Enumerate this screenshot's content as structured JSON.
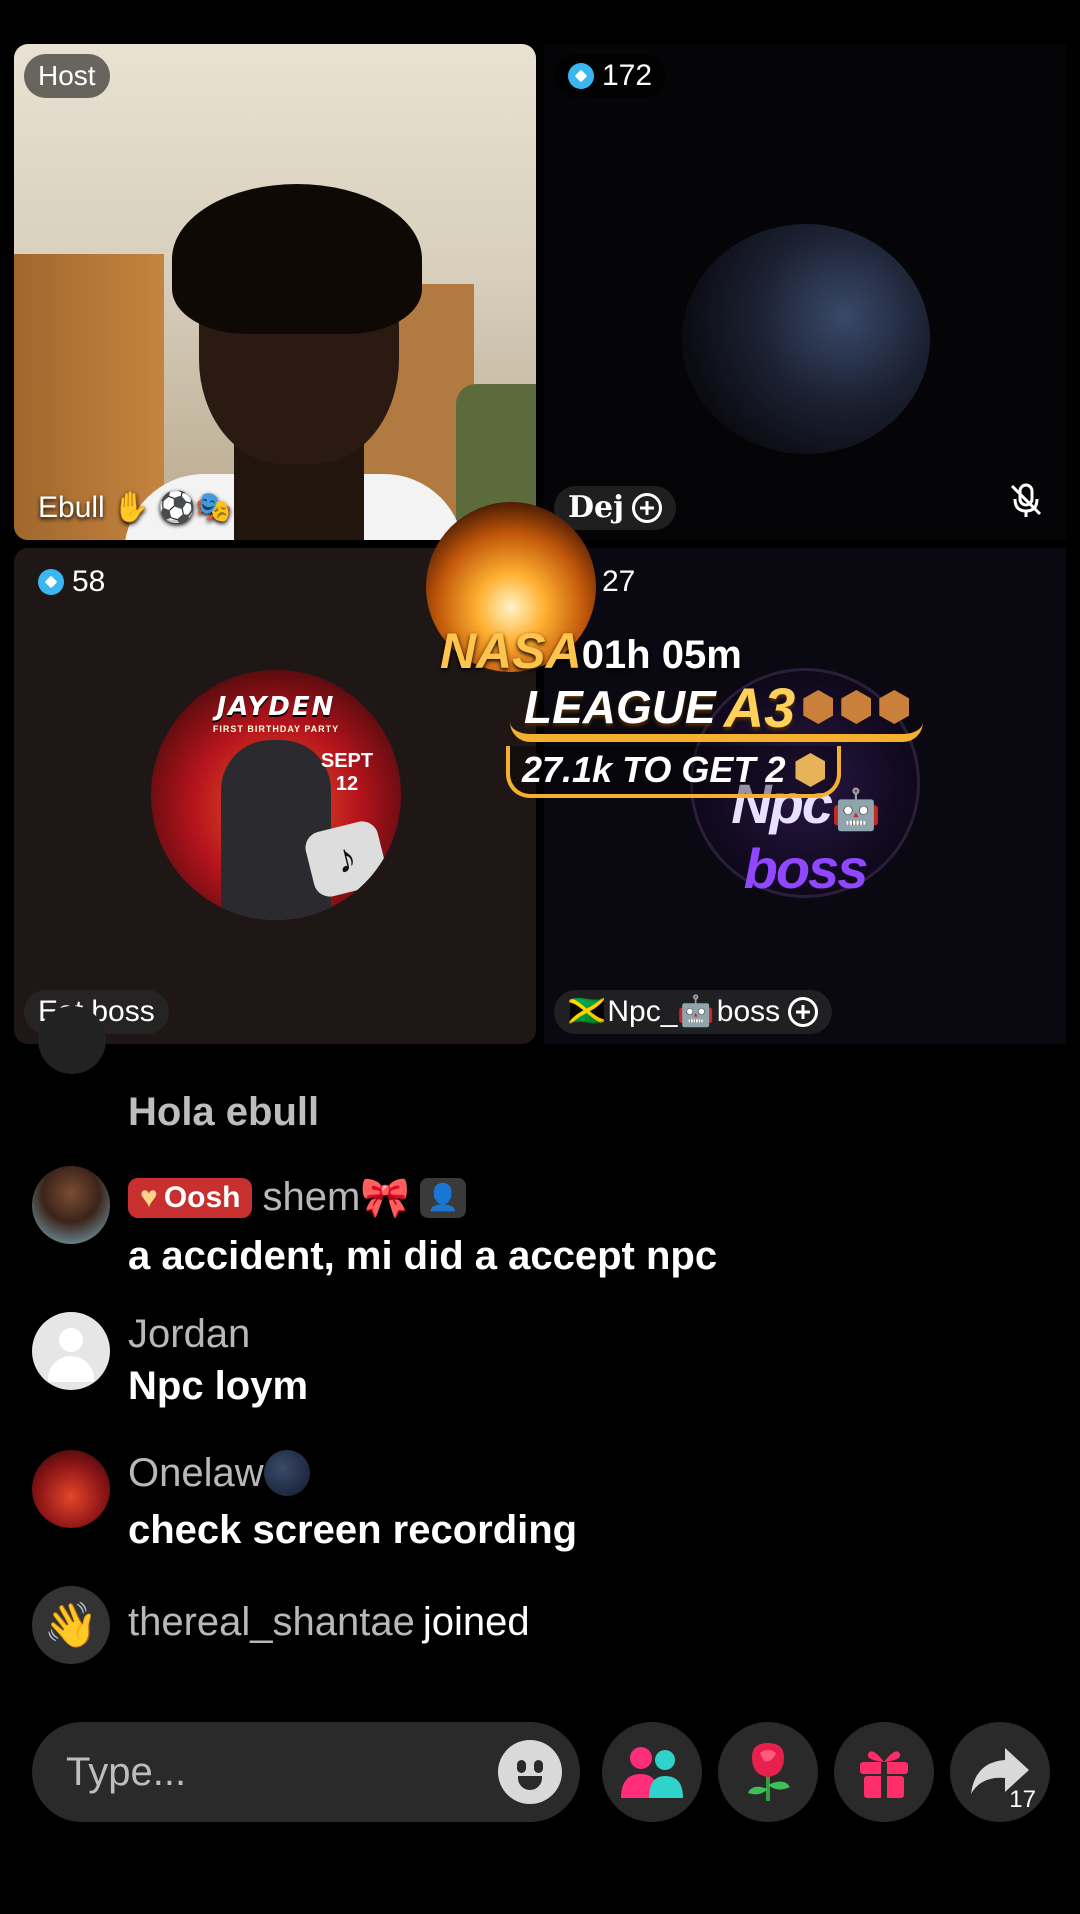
{
  "tiles": {
    "host": {
      "badge": "Host",
      "name": "Ebull",
      "name_emojis": "⚽🎭"
    },
    "dej": {
      "score": "172",
      "name": "Dej"
    },
    "eat_boss": {
      "score": "58",
      "name": "Eat boss",
      "art_title": "JAYDEN",
      "art_subtitle": "FIRST BIRTHDAY PARTY",
      "art_date": "SEPT 12"
    },
    "npc_boss": {
      "score": "27",
      "flag": "🇯🇲",
      "name_prefix": "Npc_",
      "name_robot": "🤖",
      "name_suffix": "boss",
      "logo_main": "Npc",
      "logo_robot": "🤖",
      "logo_accent": "boss"
    }
  },
  "league": {
    "banner_text": "NASA",
    "timer": "01h 05m",
    "title_prefix": "LEAGUE",
    "tier": "A3",
    "goal": "27.1k TO GET 2"
  },
  "chat": {
    "partial": {
      "message": "Hola ebull"
    },
    "items": [
      {
        "badge": "Oosh",
        "username": "shem",
        "name_emoji": "🎀",
        "message": "a accident, mi did a accept npc"
      },
      {
        "username": "Jordan",
        "message": "Npc loym"
      },
      {
        "username": "Onelaw",
        "message": "check screen recording"
      }
    ],
    "join": {
      "username": "thereal_shantae",
      "action": "joined"
    }
  },
  "bottom_bar": {
    "input_placeholder": "Type...",
    "share_count": "17"
  },
  "colors": {
    "accent": "#f5b02f",
    "badge_red": "#c7302e",
    "diamond": "#3ab7f0"
  }
}
